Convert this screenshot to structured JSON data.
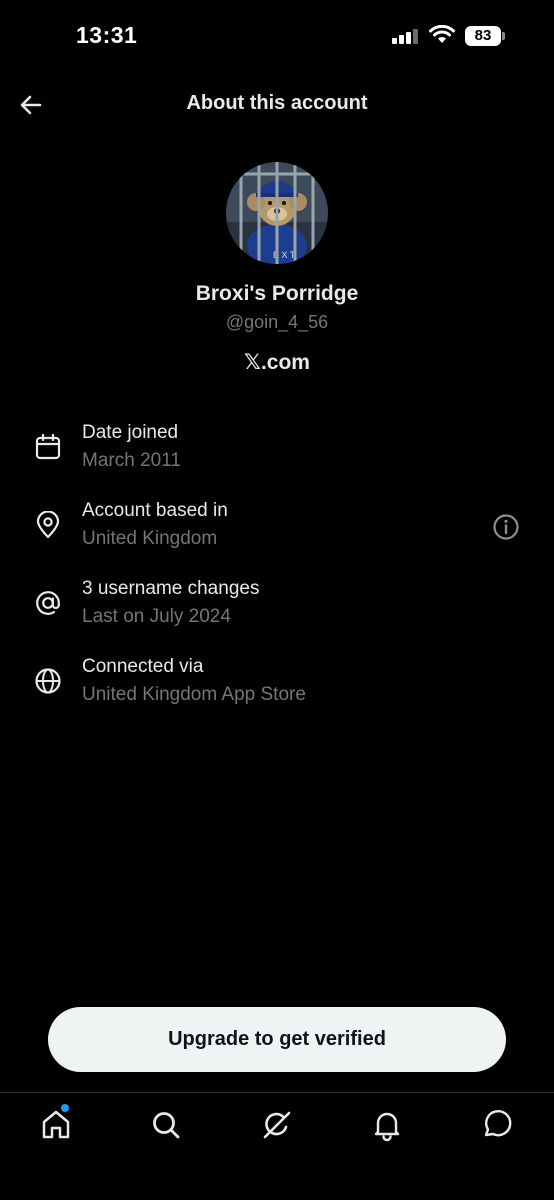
{
  "status_bar": {
    "time": "13:31",
    "battery": "83"
  },
  "header": {
    "title": "About this account",
    "back_icon": "arrow-left-icon"
  },
  "profile": {
    "display_name": "Broxi's Porridge",
    "handle": "@goin_4_56",
    "site": "𝕏.com"
  },
  "info_rows": [
    {
      "icon": "calendar-icon",
      "title": "Date joined",
      "subtitle": "March 2011"
    },
    {
      "icon": "location-pin-icon",
      "title": "Account based in",
      "subtitle": "United Kingdom",
      "extra_icon": "info-icon"
    },
    {
      "icon": "at-sign-icon",
      "title": "3 username changes",
      "subtitle": "Last on July 2024"
    },
    {
      "icon": "globe-icon",
      "title": "Connected via",
      "subtitle": "United Kingdom App Store"
    }
  ],
  "upgrade_button": {
    "label": "Upgrade to get verified"
  },
  "bottom_nav": [
    {
      "icon": "home-icon",
      "has_badge": true
    },
    {
      "icon": "search-icon"
    },
    {
      "icon": "grok-icon"
    },
    {
      "icon": "bell-icon"
    },
    {
      "icon": "messages-icon"
    }
  ],
  "colors": {
    "background": "#000000",
    "primary_text": "#e7e9ea",
    "secondary_text": "#71767b",
    "accent": "#1d9bf0"
  }
}
